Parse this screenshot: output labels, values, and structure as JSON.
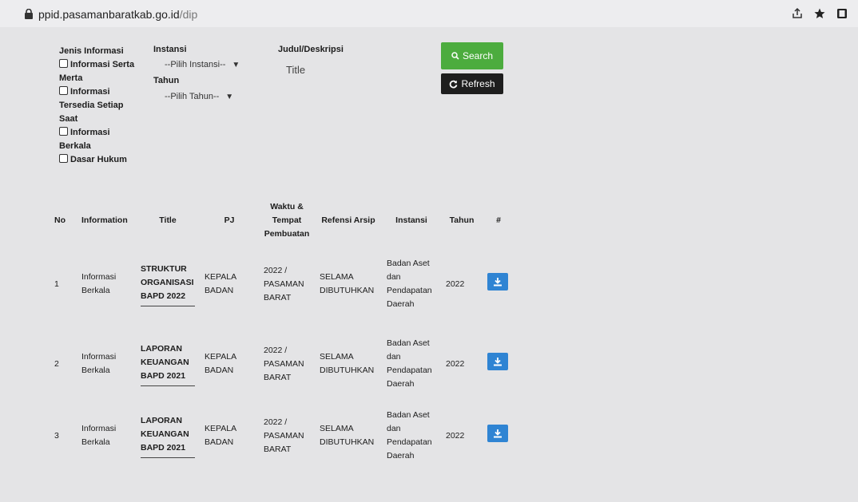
{
  "browser": {
    "url_domain": "ppid.pasamanbaratkab.go.id",
    "url_path": "/dip"
  },
  "filters": {
    "jenis_label": "Jenis Informasi",
    "jenis_options": [
      "Informasi Serta Merta",
      "Informasi Tersedia Setiap Saat",
      "Informasi Berkala",
      "Dasar Hukum"
    ],
    "instansi_label": "Instansi",
    "instansi_selected": "--Pilih Instansi--",
    "tahun_label": "Tahun",
    "tahun_selected": "--Pilih Tahun--",
    "judul_label": "Judul/Deskripsi",
    "judul_placeholder": "Title",
    "search_label": "Search",
    "refresh_label": "Refresh"
  },
  "table": {
    "headers": [
      "No",
      "Information",
      "Title",
      "PJ",
      "Waktu & Tempat Pembuatan",
      "Refensi Arsip",
      "Instansi",
      "Tahun",
      "#"
    ],
    "rows": [
      {
        "no": "1",
        "information": "Informasi Berkala",
        "title": "STRUKTUR ORGANISASI BAPD 2022",
        "pj": "KEPALA BADAN",
        "waktu": "2022 / PASAMAN BARAT",
        "referensi": "SELAMA DIBUTUHKAN",
        "instansi": "Badan Aset dan Pendapatan Daerah",
        "tahun": "2022"
      },
      {
        "no": "2",
        "information": "Informasi Berkala",
        "title": "LAPORAN KEUANGAN BAPD 2021",
        "pj": "KEPALA BADAN",
        "waktu": "2022 / PASAMAN BARAT",
        "referensi": "SELAMA DIBUTUHKAN",
        "instansi": "Badan Aset dan Pendapatan Daerah",
        "tahun": "2022"
      },
      {
        "no": "3",
        "information": "Informasi Berkala",
        "title": "LAPORAN KEUANGAN BAPD 2021",
        "pj": "KEPALA BADAN",
        "waktu": "2022 / PASAMAN BARAT",
        "referensi": "SELAMA DIBUTUHKAN",
        "instansi": "Badan Aset dan Pendapatan Daerah",
        "tahun": "2022"
      }
    ]
  },
  "colors": {
    "search_button": "#4cac3e",
    "refresh_button": "#1e1e1e",
    "download_button": "#2f84d3"
  }
}
